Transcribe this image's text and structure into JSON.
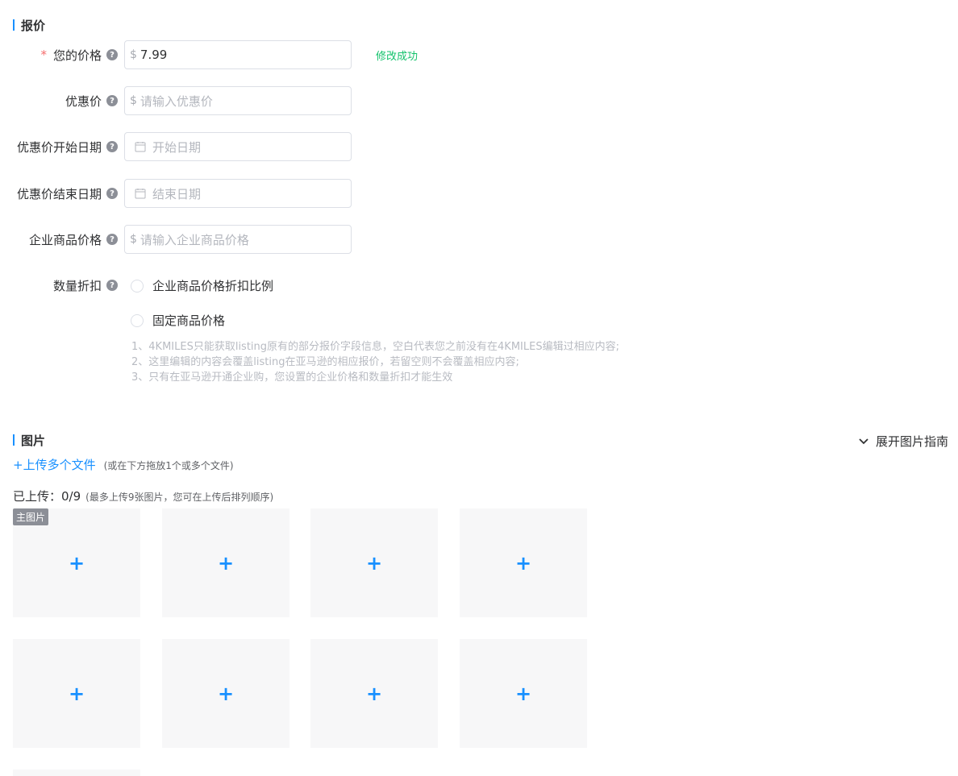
{
  "pricing": {
    "title": "报价",
    "your_price": {
      "label": "您的价格",
      "required_mark": "*",
      "prefix": "$",
      "value": "7.99",
      "success": "修改成功"
    },
    "sale_price": {
      "label": "优惠价",
      "prefix": "$",
      "placeholder": "请输入优惠价"
    },
    "sale_start": {
      "label": "优惠价开始日期",
      "placeholder": "开始日期"
    },
    "sale_end": {
      "label": "优惠价结束日期",
      "placeholder": "结束日期"
    },
    "business_price": {
      "label": "企业商品价格",
      "prefix": "$",
      "placeholder": "请输入企业商品价格"
    },
    "qty_discount": {
      "label": "数量折扣",
      "options": [
        "企业商品价格折扣比例",
        "固定商品价格"
      ]
    },
    "notes": [
      "1、4KMILES只能获取listing原有的部分报价字段信息，空白代表您之前没有在4KMILES编辑过相应内容;",
      "2、这里编辑的内容会覆盖listing在亚马逊的相应报价，若留空则不会覆盖相应内容;",
      "3、只有在亚马逊开通企业购，您设置的企业价格和数量折扣才能生效"
    ]
  },
  "images": {
    "title": "图片",
    "expand_guide": "展开图片指南",
    "upload_link": "+上传多个文件",
    "upload_hint": "(或在下方拖放1个或多个文件)",
    "uploaded_label": "已上传：0/9",
    "uploaded_hint": "(最多上传9张图片，您可在上传后排列顺序)",
    "main_badge": "主图片",
    "plus": "+",
    "slot_count": 9
  },
  "icons": {
    "help": "question-circle-icon",
    "calendar": "calendar-icon",
    "chevron": "chevron-down-icon"
  },
  "colors": {
    "accent": "#1890ff",
    "success": "#13c26b",
    "required": "#f56c6c"
  }
}
